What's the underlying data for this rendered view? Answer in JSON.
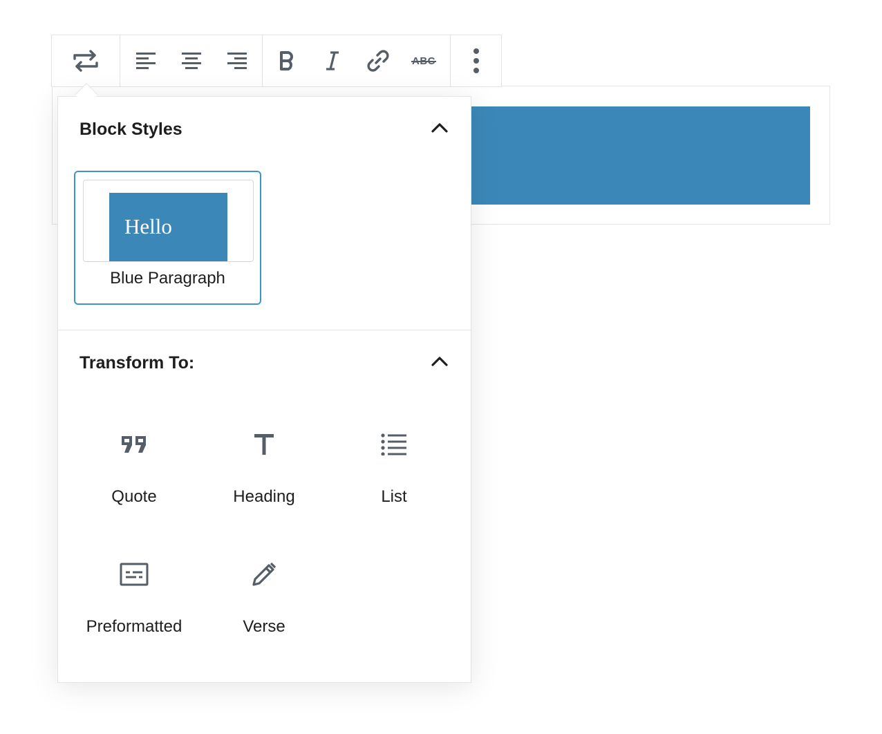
{
  "toolbar": {
    "buttons": [
      {
        "name": "transform-block",
        "icon": "transform-icon"
      },
      {
        "name": "align-left",
        "icon": "align-left-icon"
      },
      {
        "name": "align-center",
        "icon": "align-center-icon"
      },
      {
        "name": "align-right",
        "icon": "align-right-icon"
      },
      {
        "name": "bold",
        "icon": "bold-icon"
      },
      {
        "name": "italic",
        "icon": "italic-icon"
      },
      {
        "name": "link",
        "icon": "link-icon"
      },
      {
        "name": "strikethrough",
        "icon": "strikethrough-icon",
        "text": "ABC"
      },
      {
        "name": "more-options",
        "icon": "more-vertical-icon"
      }
    ]
  },
  "block": {
    "background_color": "#3b88b8"
  },
  "popover": {
    "block_styles": {
      "title": "Block Styles",
      "styles": [
        {
          "label": "Blue Paragraph",
          "preview_text": "Hello",
          "selected": true
        }
      ]
    },
    "transform": {
      "title": "Transform To:",
      "items": [
        {
          "label": "Quote",
          "icon": "quote-icon"
        },
        {
          "label": "Heading",
          "icon": "heading-icon"
        },
        {
          "label": "List",
          "icon": "list-icon"
        },
        {
          "label": "Preformatted",
          "icon": "preformatted-icon"
        },
        {
          "label": "Verse",
          "icon": "pencil-icon"
        }
      ]
    }
  },
  "colors": {
    "accent": "#3b96c7",
    "icon": "#555d66",
    "border": "#e2e4e7"
  }
}
